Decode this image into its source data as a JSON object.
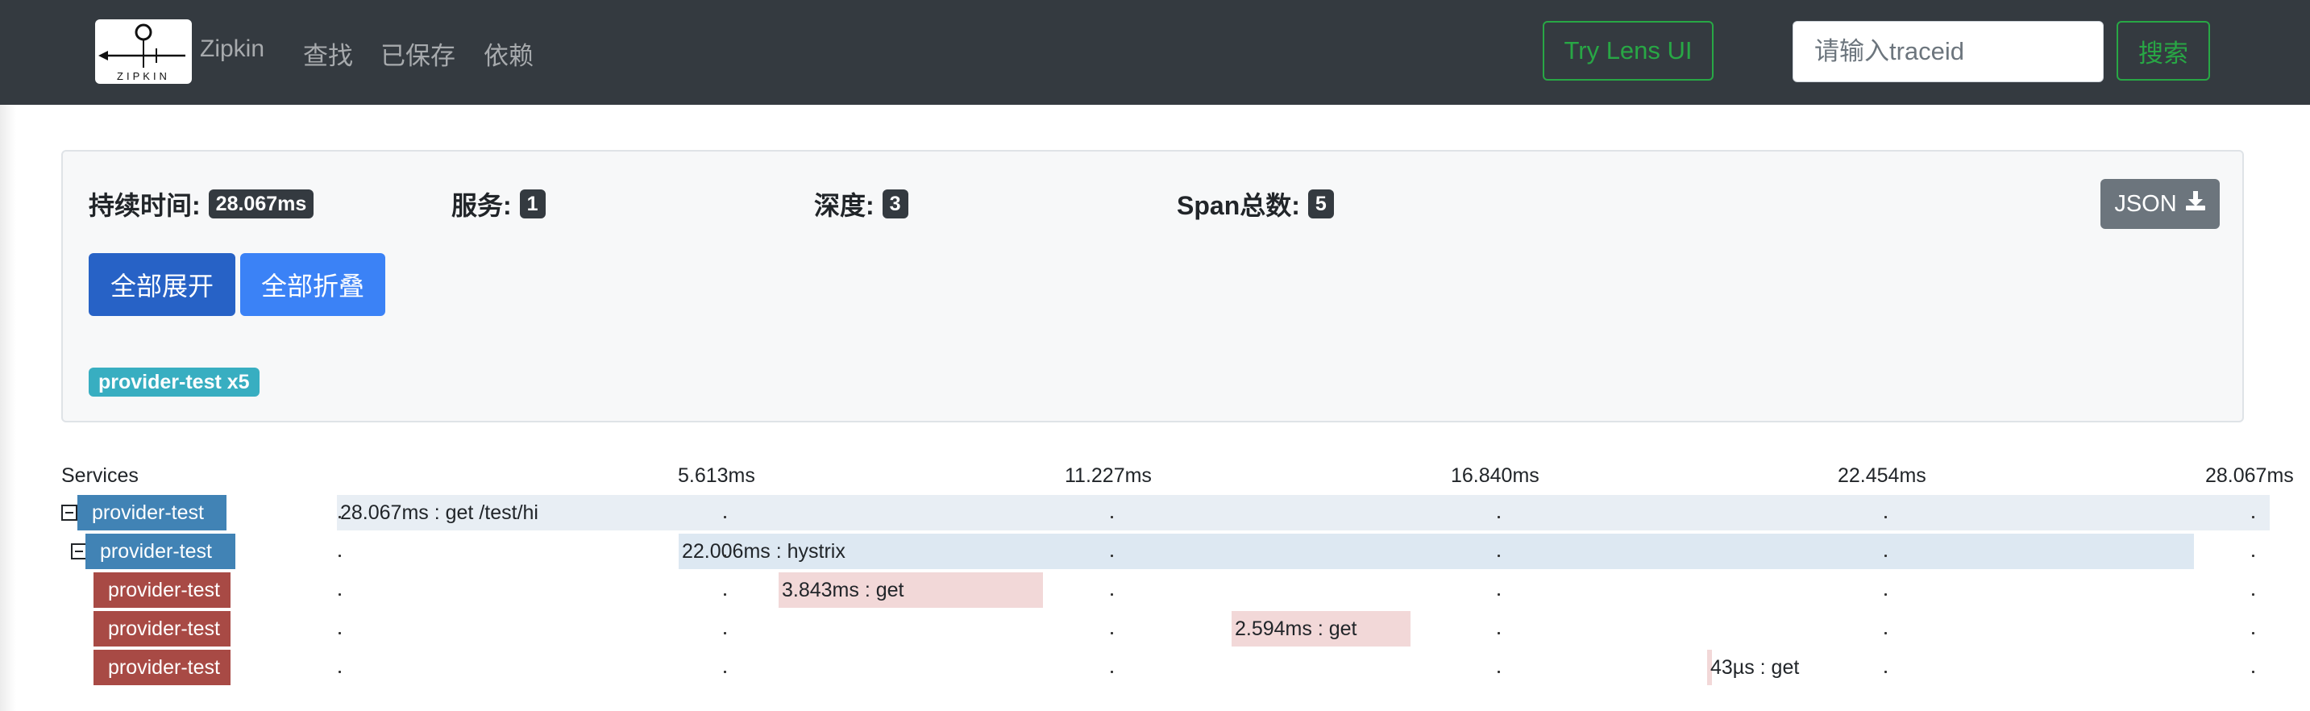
{
  "navbar": {
    "logo_text": "ZIPKIN",
    "brand": "Zipkin",
    "links": [
      "查找",
      "已保存",
      "依赖"
    ],
    "lens_button": "Try Lens UI",
    "search_placeholder": "请输入traceid",
    "search_button": "搜索",
    "accent_color": "#28a745"
  },
  "summary": {
    "duration_label": "持续时间:",
    "duration_value": "28.067ms",
    "services_label": "服务:",
    "services_value": "1",
    "depth_label": "深度:",
    "depth_value": "3",
    "span_total_label": "Span总数:",
    "span_total_value": "5",
    "json_button": "JSON",
    "json_icon": "download-icon",
    "expand_all": "全部展开",
    "collapse_all": "全部折叠",
    "service_tag": "provider-test x5"
  },
  "timeline": {
    "services_header": "Services",
    "ticks": [
      "5.613ms",
      "11.227ms",
      "16.840ms",
      "22.454ms",
      "28.067ms"
    ],
    "spans": [
      {
        "service": "provider-test",
        "label": "28.067ms : get /test/hi",
        "start_ms": 0,
        "duration_ms": 28.067,
        "depth": 0,
        "collapsible": true
      },
      {
        "service": "provider-test",
        "label": "22.006ms : hystrix",
        "start_ms": 5.0,
        "duration_ms": 22.006,
        "depth": 1,
        "collapsible": true
      },
      {
        "service": "provider-test",
        "label": "3.843ms : get",
        "start_ms": 6.4,
        "duration_ms": 3.843,
        "depth": 2,
        "collapsible": false
      },
      {
        "service": "provider-test",
        "label": "2.594ms : get",
        "start_ms": 13.0,
        "duration_ms": 2.594,
        "depth": 2,
        "collapsible": false
      },
      {
        "service": "provider-test",
        "label": "43µs : get",
        "start_ms": 19.9,
        "duration_ms": 0.043,
        "depth": 2,
        "collapsible": false
      }
    ],
    "colors": {
      "parent_label": "#4183b5",
      "leaf_label": "#a84a45",
      "parent_bar": "#dde8f2",
      "leaf_bar": "#f2d8d8"
    }
  }
}
